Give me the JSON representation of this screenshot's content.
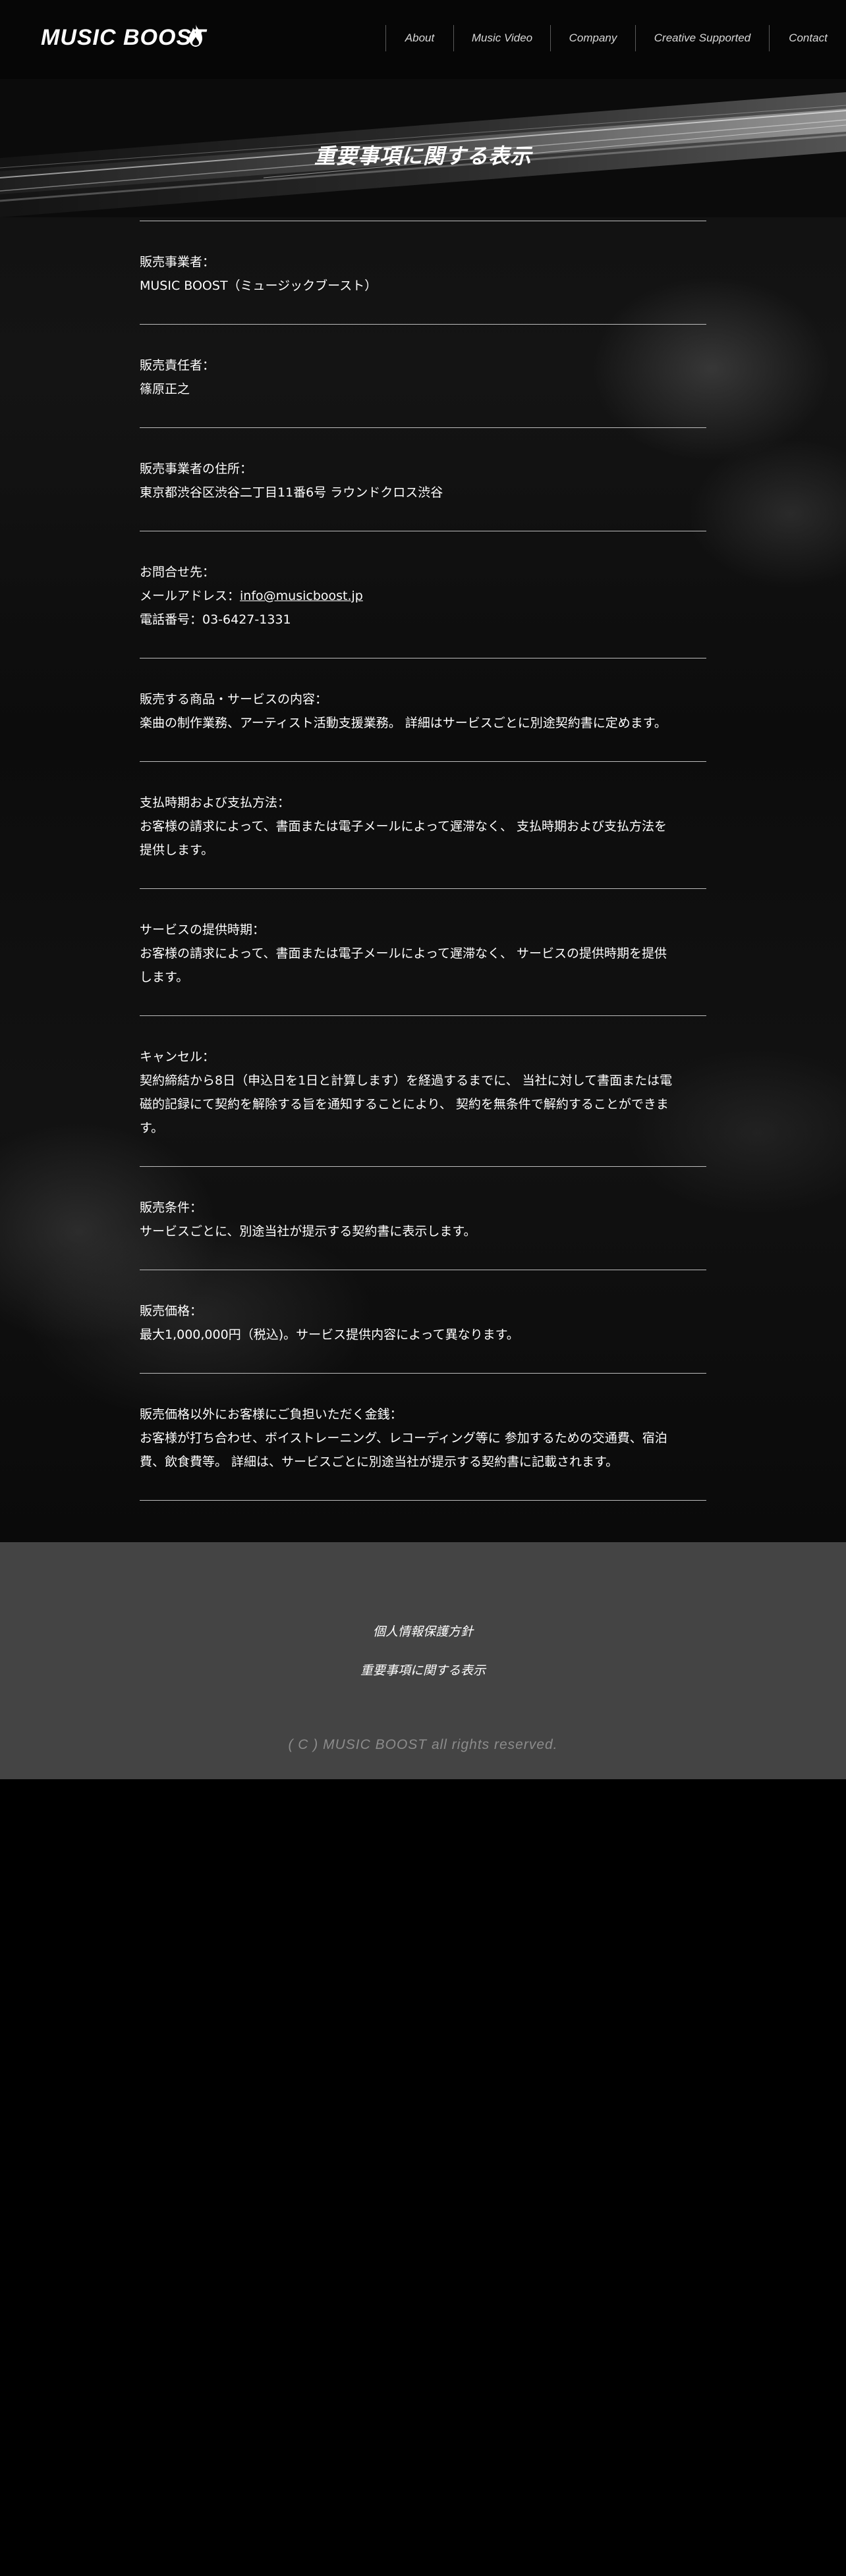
{
  "brand": {
    "logo_text": "MUSIC BOOST"
  },
  "nav": {
    "items": [
      {
        "label": "About"
      },
      {
        "label": "Music Video"
      },
      {
        "label": "Company"
      },
      {
        "label": "Creative Supported"
      },
      {
        "label": "Contact"
      }
    ]
  },
  "page": {
    "title": "重要事項に関する表示"
  },
  "sections": [
    {
      "label": "販売事業者：",
      "lines": [
        "MUSIC BOOST（ミュージックブースト）"
      ]
    },
    {
      "label": "販売責任者：",
      "lines": [
        "篠原正之"
      ]
    },
    {
      "label": "販売事業者の住所：",
      "lines": [
        "東京都渋谷区渋谷二丁目11番6号 ラウンドクロス渋谷"
      ]
    },
    {
      "label": "お問合せ先：",
      "email_prefix": "メールアドレス：",
      "email": "info@musicboost.jp",
      "phone": "電話番号：03-6427-1331"
    },
    {
      "label": "販売する商品・サービスの内容：",
      "lines": [
        "楽曲の制作業務、アーティスト活動支援業務。 詳細はサービスごとに別途契約書に定めます。"
      ]
    },
    {
      "label": "支払時期および支払方法：",
      "lines": [
        "お客様の請求によって、書面または電子メールによって遅滞なく、 支払時期および支払方法を",
        "提供します。"
      ]
    },
    {
      "label": "サービスの提供時期：",
      "lines": [
        "お客様の請求によって、書面または電子メールによって遅滞なく、 サービスの提供時期を提供",
        "します。"
      ]
    },
    {
      "label": "キャンセル：",
      "lines": [
        "契約締結から8日（申込日を1日と計算します）を経過するまでに、 当社に対して書面または電",
        "磁的記録にて契約を解除する旨を通知することにより、 契約を無条件で解約することができま",
        "す。"
      ]
    },
    {
      "label": "販売条件：",
      "lines": [
        "サービスごとに、別途当社が提示する契約書に表示します。"
      ]
    },
    {
      "label": "販売価格：",
      "lines": [
        "最大1,000,000円（税込)。サービス提供内容によって異なります。"
      ]
    },
    {
      "label": "販売価格以外にお客様にご負担いただく金銭：",
      "lines": [
        "お客様が打ち合わせ、ボイストレーニング、レコーディング等に 参加するための交通費、宿泊",
        "費、飲食費等。 詳細は、サービスごとに別途当社が提示する契約書に記載されます。"
      ]
    }
  ],
  "footer": {
    "links": [
      "個人情報保護方針",
      "重要事項に関する表示"
    ],
    "copyright": "( C ) MUSIC BOOST all rights reserved."
  },
  "icons": {
    "logo_mark": "flame-icon"
  },
  "colors": {
    "background": "#000000",
    "footer_bg": "#444444",
    "rule": "#bdbdbd",
    "copyright": "#8c8c8c"
  }
}
